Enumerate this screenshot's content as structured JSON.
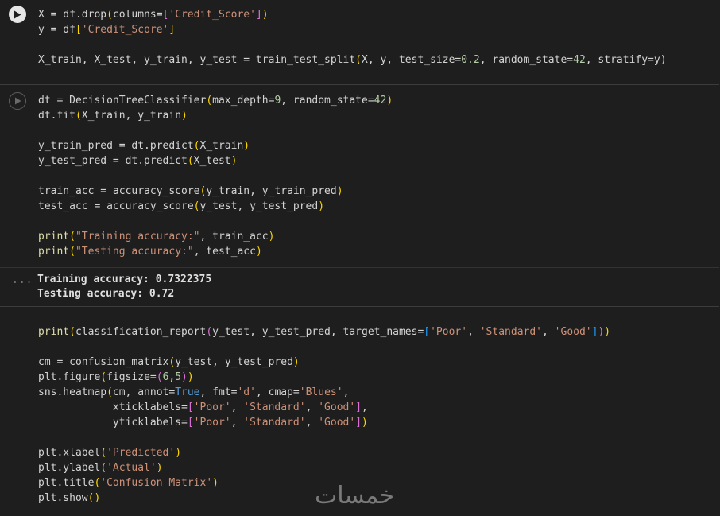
{
  "cell1": {
    "lines": [
      [
        "X = df.drop(columns=['Credit_Score'])"
      ],
      [
        "y = df['Credit_Score']"
      ],
      [
        ""
      ],
      [
        "X_train, X_test, y_train, y_test = train_test_split(X, y, test_size=0.2, random_state=42, stratify=y)"
      ]
    ]
  },
  "cell2": {
    "lines": [
      "dt = DecisionTreeClassifier(max_depth=9, random_state=42)",
      "dt.fit(X_train, y_train)",
      "",
      "y_train_pred = dt.predict(X_train)",
      "y_test_pred = dt.predict(X_test)",
      "",
      "train_acc = accuracy_score(y_train, y_train_pred)",
      "test_acc = accuracy_score(y_test, y_test_pred)",
      "",
      "print(\"Training accuracy:\", train_acc)",
      "print(\"Testing accuracy:\", test_acc)"
    ],
    "output_icon": "...",
    "output": [
      "Training accuracy: 0.7322375",
      "Testing accuracy: 0.72"
    ]
  },
  "cell3": {
    "lines": [
      "print(classification_report(y_test, y_test_pred, target_names=['Poor', 'Standard', 'Good']))",
      "",
      "cm = confusion_matrix(y_test, y_test_pred)",
      "plt.figure(figsize=(6,5))",
      "sns.heatmap(cm, annot=True, fmt='d', cmap='Blues',",
      "            xticklabels=['Poor', 'Standard', 'Good'],",
      "            yticklabels=['Poor', 'Standard', 'Good'])",
      "",
      "plt.xlabel('Predicted')",
      "plt.ylabel('Actual')",
      "plt.title('Confusion Matrix')",
      "plt.show()"
    ]
  },
  "watermark": "خمسات",
  "icons": {
    "run_active": "play-icon",
    "run_idle": "play-icon",
    "output": "ellipsis-icon"
  }
}
